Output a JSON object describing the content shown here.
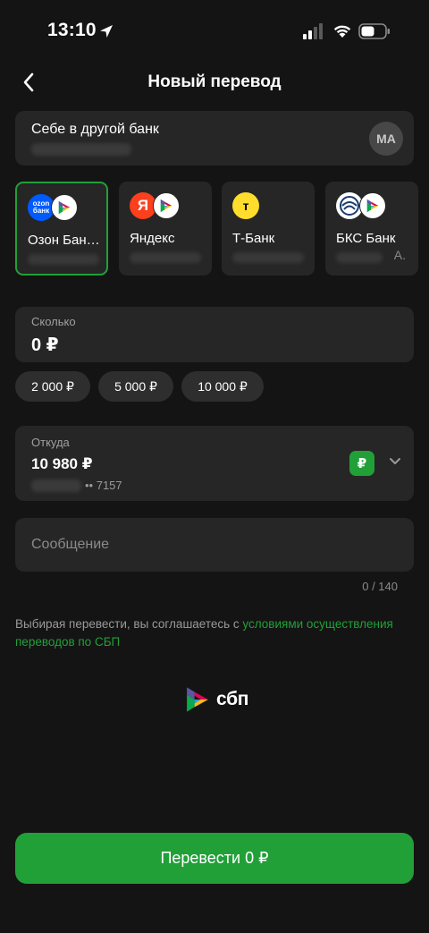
{
  "status_bar": {
    "time": "13:10",
    "icons": [
      "location-arrow-icon",
      "signal-icon",
      "wifi-icon",
      "battery-icon"
    ]
  },
  "header": {
    "title": "Новый перевод",
    "back_icon": "chevron-left-icon"
  },
  "recipient": {
    "title": "Себе в другой банк",
    "avatar_initials": "МА"
  },
  "banks": [
    {
      "name": "Озон Бан…",
      "logo": "ozon-bank-logo",
      "logo_text": "ozon\nбанк",
      "logo_color": "#005bff",
      "selected": true
    },
    {
      "name": "Яндекс",
      "logo": "yandex-logo",
      "logo_text": "Я",
      "logo_color": "#fc3f1d",
      "selected": false
    },
    {
      "name": "Т-Банк",
      "logo": "tbank-logo",
      "logo_text": "т",
      "logo_color": "#ffdd2d",
      "selected": false
    },
    {
      "name": "БКС Банк",
      "logo": "bks-logo",
      "logo_text": "",
      "logo_color": "#ffffff",
      "selected": false,
      "sub_suffix": "А."
    }
  ],
  "amount": {
    "label": "Сколько",
    "value": "0 ₽"
  },
  "quick_amounts": [
    "2 000 ₽",
    "5 000 ₽",
    "10 000 ₽"
  ],
  "source": {
    "label": "Откуда",
    "balance": "10 980 ₽",
    "card_suffix": "•• 7157",
    "currency_badge": "₽"
  },
  "message": {
    "placeholder": "Сообщение",
    "counter": "0 / 140"
  },
  "consent": {
    "text": "Выбирая перевести, вы соглашаетесь с ",
    "link": "условиями осуществления переводов по СБП"
  },
  "sbp": {
    "text": "сбп"
  },
  "submit": {
    "label": "Перевести 0 ₽"
  },
  "colors": {
    "accent": "#21a038",
    "background": "#141414",
    "card": "#262626"
  }
}
